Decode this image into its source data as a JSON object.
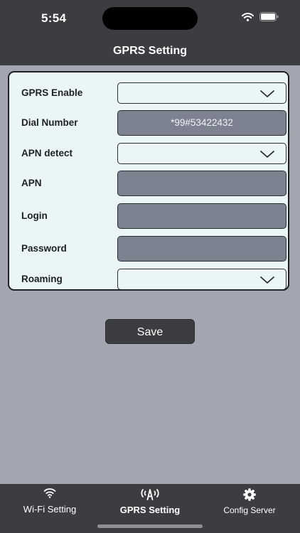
{
  "status_bar": {
    "time": "5:54"
  },
  "nav": {
    "title": "GPRS Setting"
  },
  "form": {
    "gprs_enable": {
      "label": "GPRS Enable",
      "value": ""
    },
    "dial_number": {
      "label": "Dial Number",
      "value": "*99#53422432"
    },
    "apn_detect": {
      "label": "APN detect",
      "value": ""
    },
    "apn": {
      "label": "APN",
      "value": ""
    },
    "login": {
      "label": "Login",
      "value": ""
    },
    "password": {
      "label": "Password",
      "value": ""
    },
    "roaming": {
      "label": "Roaming",
      "value": ""
    }
  },
  "actions": {
    "save_label": "Save"
  },
  "tabs": [
    {
      "label": "Wi-Fi Setting",
      "icon": "wifi-icon",
      "selected": false
    },
    {
      "label": "GPRS Setting",
      "icon": "antenna-icon",
      "selected": true
    },
    {
      "label": "Config Server",
      "icon": "gear-icon",
      "selected": false
    }
  ],
  "colors": {
    "nav_background": "#3b3d41",
    "page_background": "#a3a6b1",
    "card_background": "#eaf6f6",
    "input_background": "#7d8291"
  }
}
